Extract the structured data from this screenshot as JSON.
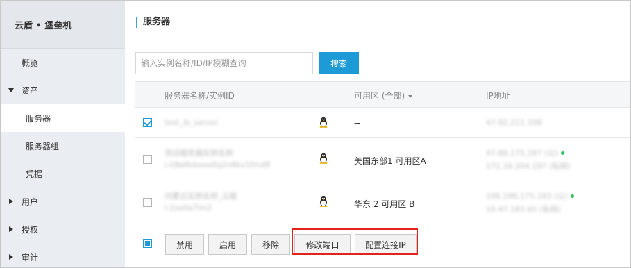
{
  "sidebar": {
    "brand": "云盾 • 堡垒机",
    "items": [
      {
        "label": "概览",
        "level": "top",
        "expand": "none"
      },
      {
        "label": "资产",
        "level": "top",
        "expand": "down"
      },
      {
        "label": "服务器",
        "level": "sub",
        "active": true
      },
      {
        "label": "服务器组",
        "level": "sub"
      },
      {
        "label": "凭据",
        "level": "sub"
      },
      {
        "label": "用户",
        "level": "top",
        "expand": "right"
      },
      {
        "label": "授权",
        "level": "top",
        "expand": "right"
      },
      {
        "label": "审计",
        "level": "top",
        "expand": "right"
      }
    ]
  },
  "main": {
    "title": "服务器",
    "search": {
      "placeholder": "输入实例名称/ID/IP模糊查询",
      "value": "",
      "button": "搜索"
    },
    "table": {
      "columns": {
        "name": "服务器名称/实例ID",
        "zone": "可用区 (全部)",
        "ip": "IP地址"
      },
      "rows": [
        {
          "checked": true,
          "name": "test_ib_server",
          "id": "",
          "os_icon": "linux-penguin-icon",
          "zone": "--",
          "ip1": "47.92.211.108",
          "ip2": ""
        },
        {
          "checked": false,
          "name": "测试服务器实例名称",
          "id": "i-rj9a8xboox0q2n8kv1fmd9",
          "os_icon": "linux-penguin-icon",
          "zone": "美国东部1 可用区A",
          "ip1": "47.88.175.167 (公)",
          "ip2": "172.16.204.187 (私网)"
        },
        {
          "checked": false,
          "name": "内蒙古实例名称_云服",
          "id": "i-2ze0a7lm2",
          "os_icon": "linux-penguin-icon",
          "zone": "华东 2 可用区 B",
          "ip1": "106.186.175.183 (公)",
          "ip2": "10.47.183.65 (私网)"
        }
      ]
    },
    "actions": [
      "禁用",
      "启用",
      "移除",
      "修改端口",
      "配置连接IP"
    ],
    "colors": {
      "accent": "#1e9bd6",
      "highlight": "#e2231a",
      "online": "#2ec55e"
    }
  }
}
